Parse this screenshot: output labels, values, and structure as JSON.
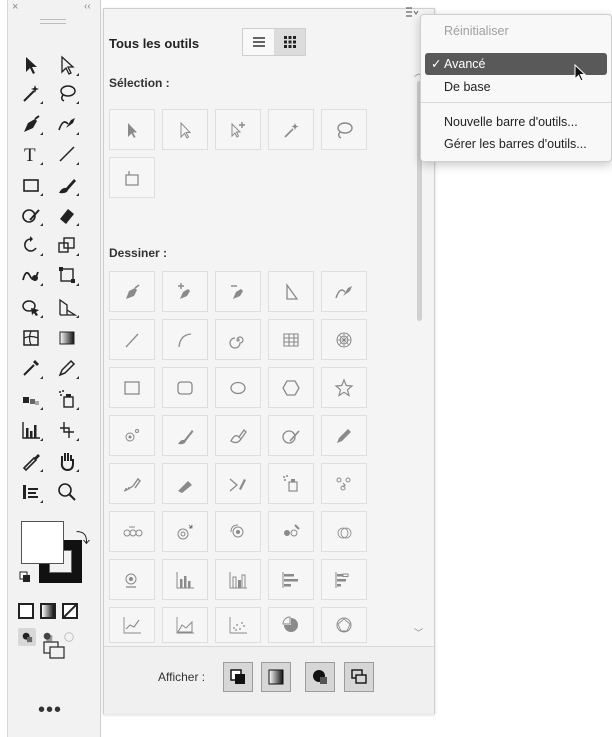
{
  "toolbar": {
    "close_glyph": "×",
    "collapse_glyph": "‹‹",
    "more_glyph": "•••",
    "tools_left": [
      "selection-tool",
      "magic-wand-tool",
      "pen-tool",
      "type-tool",
      "rectangle-tool",
      "shaper-tool",
      "rotate-tool",
      "warp-tool",
      "shape-builder-tool",
      "mesh-tool",
      "eyedropper-tool",
      "blend-tool",
      "column-graph-tool",
      "paintbrush-tool",
      "symbol-sprayer-tool"
    ],
    "tools_right": [
      "direct-selection-tool",
      "lasso-tool",
      "curvature-tool",
      "line-segment-tool",
      "paintbrush-tool",
      "eraser-tool",
      "scale-tool",
      "free-transform-tool",
      "perspective-grid-tool",
      "gradient-tool",
      "pencil-tool",
      "symbol-sprayer-tool",
      "slice-tool",
      "hand-tool",
      "zoom-tool"
    ]
  },
  "panel": {
    "title": "Tous les outils",
    "section_selection": "Sélection :",
    "section_draw": "Dessiner :",
    "footer_label": "Afficher :"
  },
  "menu": {
    "reset": "Réinitialiser",
    "advanced": "Avancé",
    "basic": "De base",
    "new_toolbar": "Nouvelle barre d'outils...",
    "manage_toolbars": "Gérer les barres d'outils...",
    "checkmark": "✓"
  },
  "colors": {
    "menu_selected": "#595959",
    "panel_bg": "#f4f4f4",
    "toolbar_bg": "#f2f2f2"
  }
}
